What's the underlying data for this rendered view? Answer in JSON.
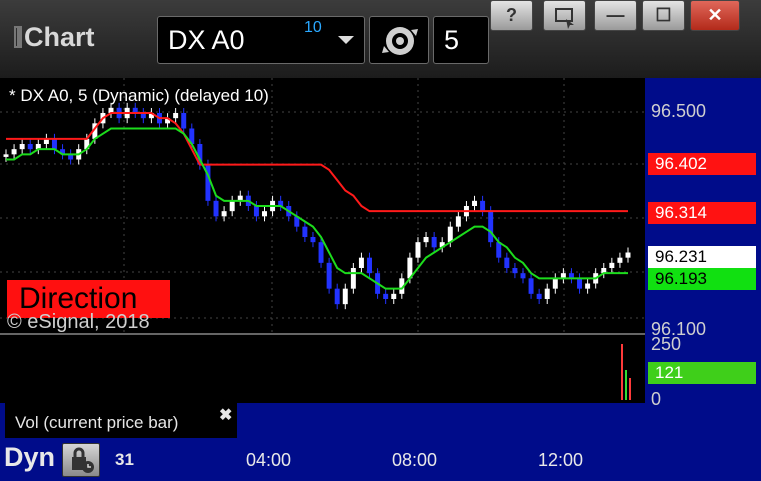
{
  "app": {
    "title": "Chart"
  },
  "toolbar": {
    "symbol": "DX A0",
    "symbol_delay_badge": "10",
    "interval": "5",
    "window_buttons": {
      "help": "?",
      "minimize": "—",
      "maximize": "☐",
      "close": "✕"
    }
  },
  "chart": {
    "label": "* DX A0, 5 (Dynamic) (delayed 10)",
    "direction_badge": "Direction",
    "copyright": "© eSignal, 2018",
    "price_axis": {
      "labels": [
        "96.500",
        "96.100"
      ]
    },
    "price_tags": [
      {
        "value": "96.402",
        "color": "#ff1212",
        "text_color": "#ffffff"
      },
      {
        "value": "96.314",
        "color": "#ff1212",
        "text_color": "#ffffff"
      },
      {
        "value": "96.231",
        "color": "#ffffff",
        "text_color": "#000000"
      },
      {
        "value": "96.193",
        "color": "#11e011",
        "text_color": "#000000"
      }
    ],
    "volume": {
      "label": "Vol (current price bar)",
      "axis_labels": [
        "250",
        "0"
      ],
      "current_tag": "121",
      "tag_color": "#3fcf1a"
    },
    "footer": {
      "mode": "Dyn",
      "date": "31",
      "time_labels": [
        "04:00",
        "08:00",
        "12:00"
      ]
    },
    "colors": {
      "up_bar": "#ffffff",
      "down_bar": "#2233ff",
      "red_line": "#ff1a1a",
      "green_line": "#1cdc1c",
      "axis_bg": "#000c8a"
    }
  },
  "chart_data": {
    "type": "line",
    "title": "* DX A0, 5 (Dynamic) (delayed 10)",
    "x_tick_labels": [
      "04:00",
      "08:00",
      "12:00"
    ],
    "ylim": [
      96.08,
      96.56
    ],
    "y_tick_labels": [
      "96.500",
      "96.100"
    ],
    "series": [
      {
        "style": "candles",
        "close": [
          96.42,
          96.43,
          96.44,
          96.43,
          96.44,
          96.45,
          96.43,
          96.42,
          96.41,
          96.43,
          96.45,
          96.48,
          96.5,
          96.51,
          96.49,
          96.51,
          96.5,
          96.49,
          96.5,
          96.48,
          96.49,
          96.5,
          96.47,
          96.44,
          96.4,
          96.33,
          96.3,
          96.31,
          96.33,
          96.34,
          96.32,
          96.3,
          96.31,
          96.33,
          96.32,
          96.3,
          96.28,
          96.26,
          96.25,
          96.21,
          96.16,
          96.13,
          96.16,
          96.2,
          96.22,
          96.19,
          96.15,
          96.14,
          96.15,
          96.18,
          96.22,
          96.25,
          96.26,
          96.24,
          96.25,
          96.28,
          96.3,
          96.32,
          96.33,
          96.31,
          96.25,
          96.22,
          96.2,
          96.19,
          96.18,
          96.15,
          96.14,
          96.16,
          96.18,
          96.19,
          96.18,
          96.16,
          96.17,
          96.19,
          96.2,
          96.21,
          96.22,
          96.23
        ]
      },
      {
        "name": "96.402",
        "style": "step",
        "values": [
          96.45,
          96.45,
          96.45,
          96.45,
          96.45,
          96.45,
          96.45,
          96.45,
          96.45,
          96.45,
          96.45,
          96.47,
          96.49,
          96.5,
          96.5,
          96.5,
          96.5,
          96.5,
          96.5,
          96.49,
          96.49,
          96.48,
          96.46,
          96.43,
          96.4,
          96.4,
          96.4,
          96.4,
          96.4,
          96.4,
          96.4,
          96.4,
          96.4,
          96.4,
          96.4,
          96.4,
          96.4,
          96.4,
          96.4,
          96.4,
          96.39,
          96.37,
          96.35,
          96.34,
          96.32,
          96.31,
          96.31,
          96.31,
          96.31,
          96.31,
          96.31,
          96.31,
          96.31,
          96.31,
          96.31,
          96.31,
          96.31,
          96.31,
          96.31,
          96.31,
          96.31,
          96.31,
          96.31,
          96.31,
          96.31,
          96.31,
          96.31,
          96.31,
          96.31,
          96.31,
          96.31,
          96.31,
          96.31,
          96.31,
          96.31,
          96.31,
          96.31,
          96.31
        ]
      },
      {
        "name": "96.193",
        "style": "line",
        "values": [
          96.41,
          96.41,
          96.42,
          96.42,
          96.43,
          96.43,
          96.43,
          96.42,
          96.42,
          96.42,
          96.43,
          96.45,
          96.46,
          96.47,
          96.47,
          96.47,
          96.47,
          96.47,
          96.47,
          96.47,
          96.47,
          96.47,
          96.46,
          96.44,
          96.41,
          96.38,
          96.34,
          96.33,
          96.33,
          96.33,
          96.33,
          96.32,
          96.32,
          96.32,
          96.32,
          96.31,
          96.3,
          96.29,
          96.28,
          96.26,
          96.23,
          96.2,
          96.19,
          96.19,
          96.19,
          96.18,
          96.17,
          96.16,
          96.16,
          96.16,
          96.18,
          96.2,
          96.22,
          96.23,
          96.24,
          96.25,
          96.26,
          96.27,
          96.28,
          96.28,
          96.27,
          96.25,
          96.24,
          96.22,
          96.21,
          96.19,
          96.18,
          96.18,
          96.18,
          96.18,
          96.18,
          96.18,
          96.18,
          96.18,
          96.19,
          96.19,
          96.19,
          96.19
        ]
      }
    ],
    "volume_axis": {
      "ylim": [
        0,
        250
      ],
      "current": 121
    }
  }
}
